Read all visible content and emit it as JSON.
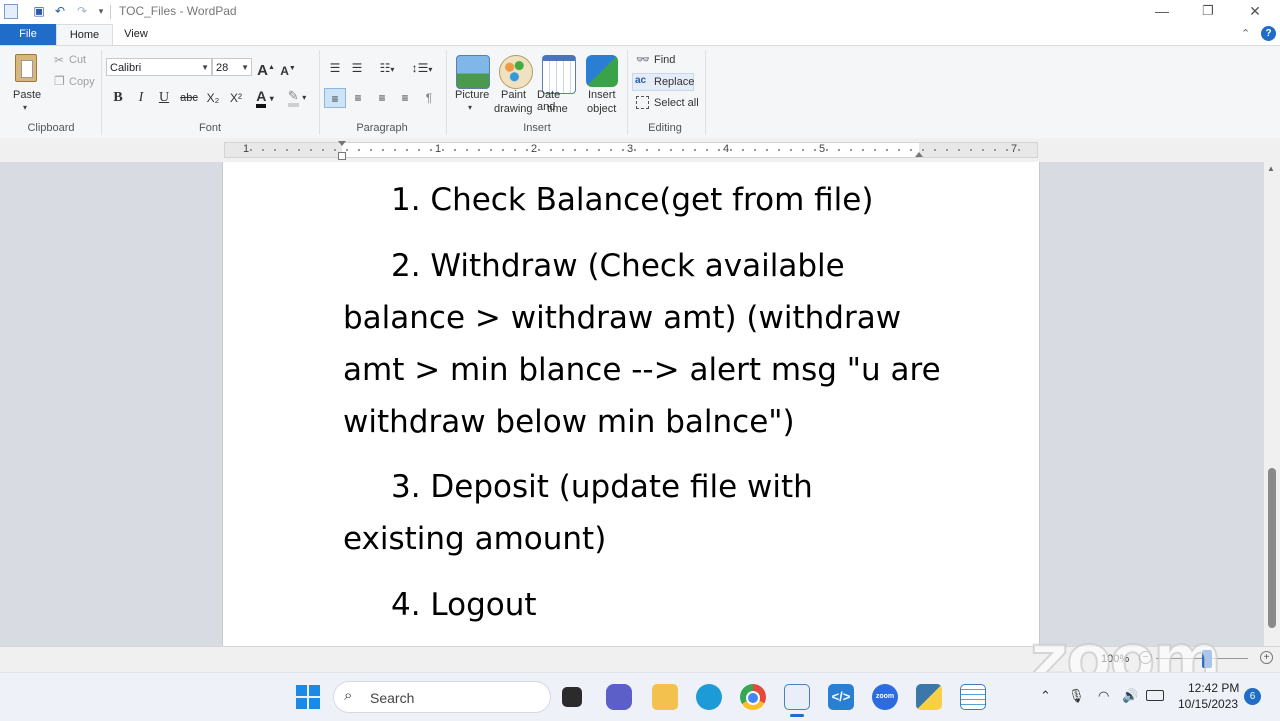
{
  "window": {
    "title": "TOC_Files - WordPad",
    "minimize_glyph": "—",
    "restore_glyph": "❐",
    "close_glyph": "✕"
  },
  "tabs": [
    {
      "label": "File",
      "active": false
    },
    {
      "label": "Home",
      "active": true
    },
    {
      "label": "View",
      "active": false
    }
  ],
  "ribbon": {
    "clipboard": {
      "group_label": "Clipboard",
      "paste_label": "Paste",
      "cut_label": "Cut",
      "copy_label": "Copy"
    },
    "font": {
      "group_label": "Font",
      "font_family": "Calibri",
      "font_size": "28",
      "bold_glyph": "B",
      "italic_glyph": "I",
      "underline_glyph": "U",
      "strike_glyph": "abc",
      "subscript_glyph": "X₂",
      "superscript_glyph": "X²",
      "grow_glyph": "A",
      "shrink_glyph": "A",
      "color_glyph": "A"
    },
    "paragraph": {
      "group_label": "Paragraph"
    },
    "insert": {
      "group_label": "Insert",
      "picture_label": "Picture",
      "paint_label_1": "Paint",
      "paint_label_2": "drawing",
      "datetime_label_1": "Date and",
      "datetime_label_2": "time",
      "object_label_1": "Insert",
      "object_label_2": "object"
    },
    "editing": {
      "group_label": "Editing",
      "find_label": "Find",
      "replace_label": "Replace",
      "select_all_label": "Select all"
    }
  },
  "ruler": {
    "numbers": [
      "1",
      "1",
      "2",
      "3",
      "4",
      "5",
      "7"
    ]
  },
  "document": {
    "lines": [
      "1. Check Balance(get from file)",
      "2. Withdraw (Check available",
      "balance > withdraw amt) (withdraw",
      "amt > min blance --> alert msg \"u are",
      "withdraw below min balnce\")",
      "3. Deposit (update file with",
      "existing amount)",
      "4. Logout"
    ]
  },
  "statusbar": {
    "zoom_level": "100%"
  },
  "watermark": {
    "text": "zoom"
  },
  "taskbar": {
    "search_placeholder": "Search",
    "apps": [
      {
        "name": "file-explorer",
        "color": "#f2c14e"
      },
      {
        "name": "edge",
        "color": "#1d9bd7"
      },
      {
        "name": "chrome",
        "color": "#e4493a"
      },
      {
        "name": "wordpad",
        "color": "#4a7cc7"
      },
      {
        "name": "vscode",
        "color": "#2a7fd4"
      },
      {
        "name": "zoom",
        "color": "#2d6ce0"
      }
    ],
    "zoom_app_label": "zoom",
    "clock_time": "12:42 PM",
    "clock_date": "10/15/2023",
    "notification_count": "6"
  }
}
